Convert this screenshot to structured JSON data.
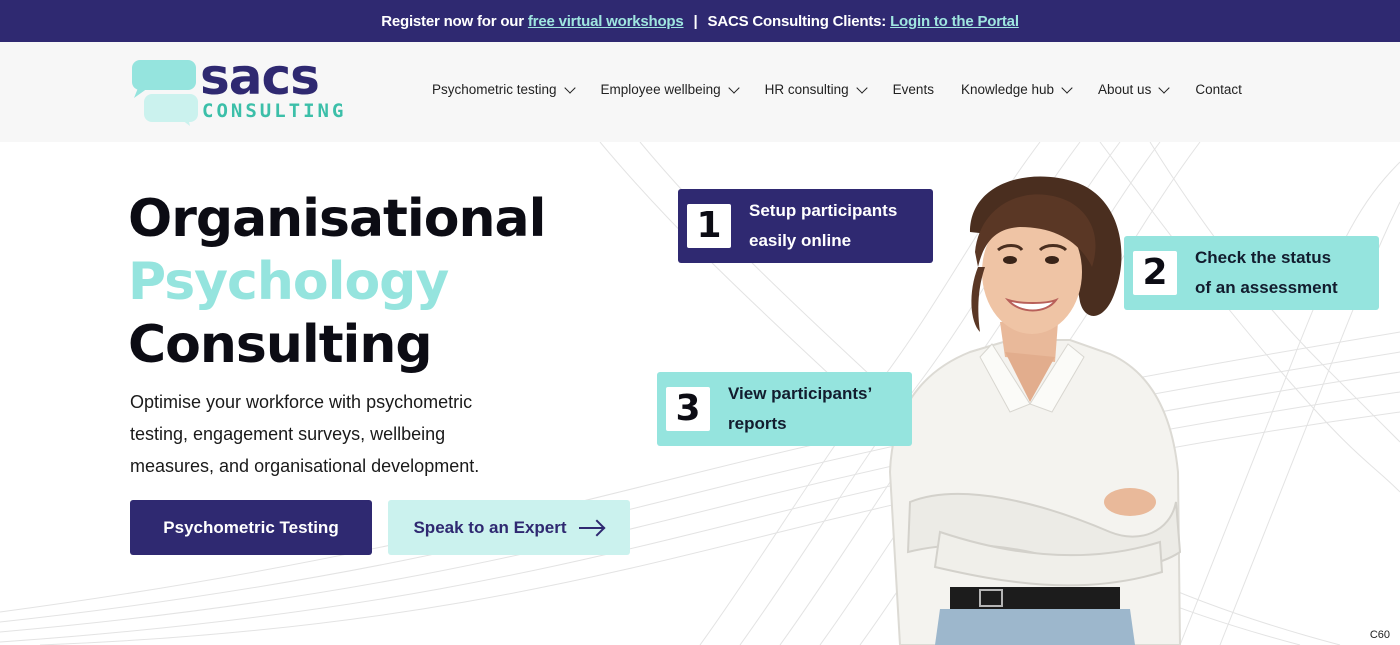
{
  "topbar": {
    "prefix": "Register now for our",
    "workshops_link": "free virtual workshops",
    "separator": "|",
    "clients_text": "SACS Consulting Clients:",
    "portal_link": "Login to the Portal"
  },
  "logo": {
    "word": "sacs",
    "sub": "CONSULTING"
  },
  "nav": {
    "items": [
      {
        "label": "Psychometric testing",
        "has_dropdown": true
      },
      {
        "label": "Employee wellbeing",
        "has_dropdown": true
      },
      {
        "label": "HR consulting",
        "has_dropdown": true
      },
      {
        "label": "Events",
        "has_dropdown": false
      },
      {
        "label": "Knowledge hub",
        "has_dropdown": true
      },
      {
        "label": "About us",
        "has_dropdown": true
      },
      {
        "label": "Contact",
        "has_dropdown": false
      }
    ]
  },
  "hero": {
    "title_line1": "Organisational",
    "title_line2": "Psychology",
    "title_line3": "Consulting",
    "description": "Optimise your workforce with psychometric testing, engagement surveys, wellbeing measures, and organisational development.",
    "primary_button": "Psychometric Testing",
    "secondary_button": "Speak to an Expert"
  },
  "steps": [
    {
      "number": "1",
      "line1": "Setup participants",
      "line2": "easily online"
    },
    {
      "number": "2",
      "line1": "Check the status",
      "line2": "of an assessment"
    },
    {
      "number": "3",
      "line1": "View participants’",
      "line2": "reports"
    }
  ],
  "corner_label": "C60",
  "colors": {
    "brand_navy": "#2f2971",
    "brand_mint": "#95e4de",
    "mint_light": "#cbf2ee",
    "link_mint": "#9fe6e0"
  }
}
